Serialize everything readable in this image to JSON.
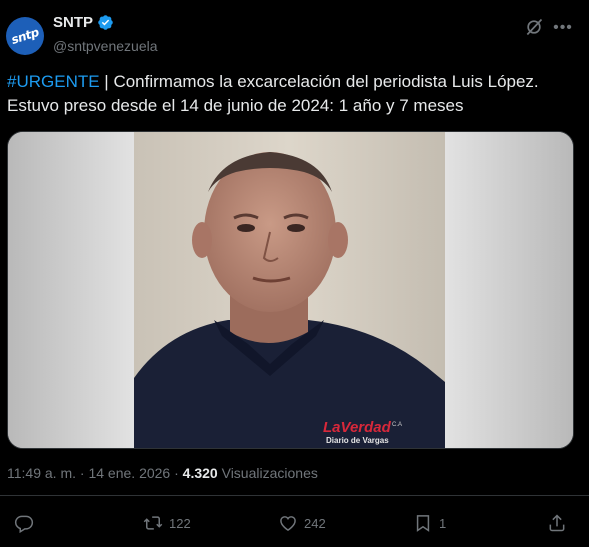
{
  "author": {
    "avatar_text": "sntp",
    "display_name": "SNTP",
    "handle": "@sntpvenezuela",
    "verified_color": "#1d9bf0"
  },
  "tweet": {
    "hashtag": "#URGENTE",
    "text": " | Confirmamos la excarcelación del periodista Luis López. Estuvo preso desde el 14 de junio de 2024: 1 año y 7 meses"
  },
  "media": {
    "shirt_brand": "LaVerdad",
    "shirt_suffix": "C.A",
    "shirt_sub": "Diario de Vargas"
  },
  "meta": {
    "time": "11:49 a. m.",
    "separator": "·",
    "date": "14 ene. 2026",
    "views_count": "4.320",
    "views_label": "Visualizaciones"
  },
  "actions": {
    "retweets": "122",
    "likes": "242",
    "bookmarks": "1"
  },
  "colors": {
    "accent": "#1d9bf0",
    "muted": "#71767b",
    "background": "#000000",
    "text": "#e7e9ea"
  }
}
